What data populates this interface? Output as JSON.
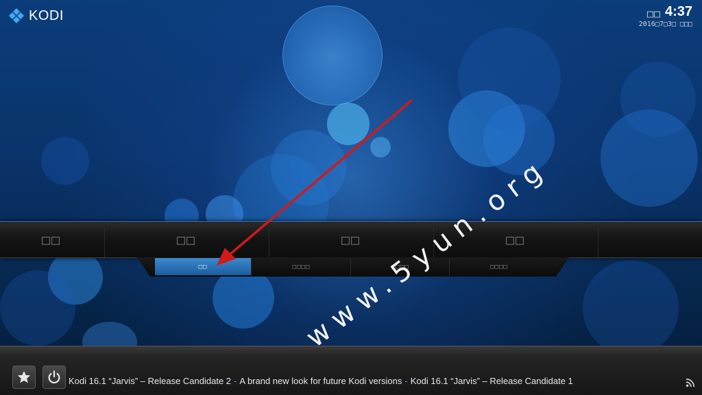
{
  "header": {
    "app_name": "KODI",
    "clock": {
      "day_label": "□□",
      "time": "4:37",
      "date": "2016□7□3□ □□□"
    }
  },
  "main_menu": {
    "items": [
      {
        "label": "□□"
      },
      {
        "label": "□□"
      },
      {
        "label": "□□"
      },
      {
        "label": "□□"
      }
    ]
  },
  "sub_menu": {
    "items": [
      {
        "label": "□□",
        "active": true
      },
      {
        "label": "□□□□",
        "active": false
      },
      {
        "label": "□□□□",
        "active": false
      },
      {
        "label": "□□□□",
        "active": false
      }
    ]
  },
  "footer": {
    "favourites_icon": "star-icon",
    "power_icon": "power-icon",
    "ticker": [
      "Kodi 16.1 “Jarvis” – Release Candidate 2",
      "A brand new look for future Kodi versions",
      "Kodi 16.1 “Jarvis” – Release Candidate 1"
    ],
    "ticker_separator": "-",
    "rss_icon": "rss-icon"
  },
  "overlay": {
    "watermark": "www.5yun.org"
  },
  "colors": {
    "accent": "#3c8ad0",
    "arrow": "#d11a1a"
  }
}
